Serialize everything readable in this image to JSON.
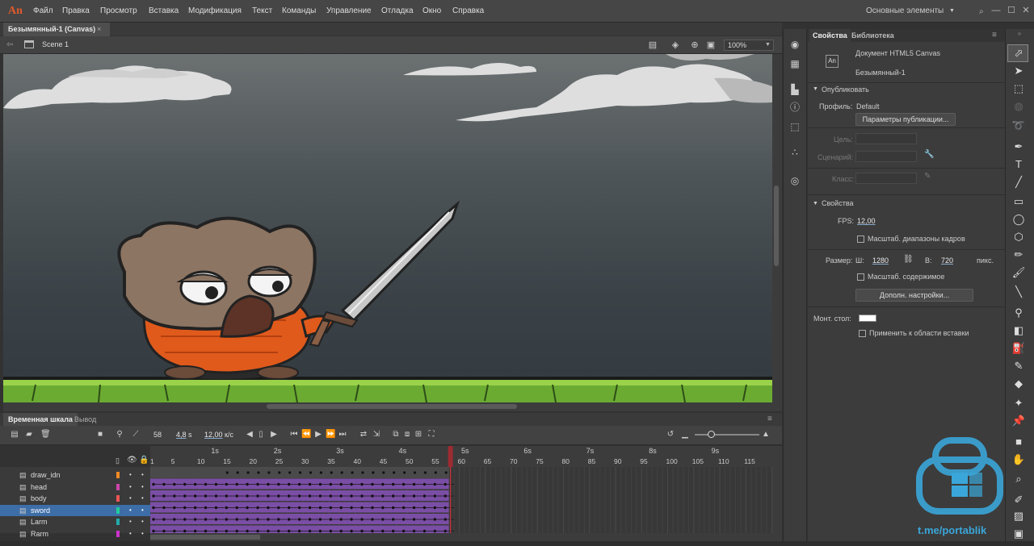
{
  "app": {
    "logo": "An"
  },
  "menu": [
    "Файл",
    "Правка",
    "Просмотр",
    "Вставка",
    "Модификация",
    "Текст",
    "Команды",
    "Управление",
    "Отладка",
    "Окно",
    "Справка"
  ],
  "workspace": "Основные элементы",
  "document": {
    "tab": "Безымянный-1 (Canvas)",
    "close": "×"
  },
  "scene": {
    "label": "Scene 1",
    "zoom": "100%"
  },
  "timeline": {
    "tabs": {
      "timeline": "Временная шкала",
      "output": "Вывод"
    },
    "frame": "58",
    "time": "4,8",
    "time_unit": "s",
    "fps": "12,00",
    "fps_unit": "к/с",
    "seconds": [
      "1s",
      "2s",
      "3s",
      "4s",
      "5s",
      "6s",
      "7s",
      "8s",
      "9s"
    ],
    "frame_numbers": [
      "1",
      "5",
      "10",
      "15",
      "20",
      "25",
      "30",
      "35",
      "40",
      "45",
      "50",
      "55",
      "60",
      "65",
      "70",
      "75",
      "80",
      "85",
      "90",
      "95",
      "100",
      "105",
      "110",
      "115"
    ],
    "current_frame": 58,
    "layers": [
      {
        "name": "draw_idn",
        "color": "#f08a24"
      },
      {
        "name": "head",
        "color": "#c4a"
      },
      {
        "name": "body",
        "color": "#e55"
      },
      {
        "name": "sword",
        "color": "#2c9",
        "selected": true
      },
      {
        "name": "Larm",
        "color": "#2aa"
      },
      {
        "name": "Rarm",
        "color": "#c3c"
      }
    ]
  },
  "properties": {
    "tabs": {
      "properties": "Свойства",
      "library": "Библиотека"
    },
    "doc_type": "Документ HTML5 Canvas",
    "doc_name": "Безымянный-1",
    "doc_icon": "An",
    "publish": {
      "header": "Опубликовать",
      "profile_label": "Профиль:",
      "profile_value": "Default",
      "settings_button": "Параметры публикации...",
      "target_label": "Цель:",
      "script_label": "Сценарий:",
      "class_label": "Класс:"
    },
    "props": {
      "header": "Свойства",
      "fps_label": "FPS:",
      "fps_value": "12,00",
      "scale_spans": "Масштаб. диапазоны кадров",
      "size_label": "Размер:",
      "w_label": "Ш:",
      "w_value": "1280",
      "h_label": "В:",
      "h_value": "720",
      "unit": "пикс.",
      "scale_content": "Масштаб. содержимое",
      "advanced_button": "Дополн. настройки...",
      "stage_label": "Монт. стол:",
      "stage_color": "#ffffff",
      "apply_paste": "Применить к области вставки"
    }
  },
  "watermark": {
    "text": "t.me/portablik"
  }
}
